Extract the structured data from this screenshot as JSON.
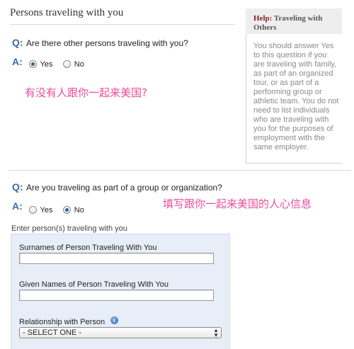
{
  "section_title": "Persons traveling with you",
  "help": {
    "label": "Help:",
    "title_line1": "Traveling with",
    "title_line2": "Others",
    "body": "You should answer Yes to this question if you are traveling with family, as part of an organized tour, or as part of a performing group or athletic team. You do not need to list individuals who are traveling with you for the purposes of employment with the same employer."
  },
  "q1": {
    "q_marker": "Q:",
    "question": "Are there other persons traveling with you?",
    "a_marker": "A:",
    "options": [
      "Yes",
      "No"
    ],
    "selected": "Yes",
    "annotation": "有没有人跟你一起来美国?"
  },
  "q2": {
    "q_marker": "Q:",
    "question": "Are you traveling as part of a group or organization?",
    "a_marker": "A:",
    "options": [
      "Yes",
      "No"
    ],
    "selected": "No",
    "annotation": "填写跟你一起来美国的人心信息"
  },
  "form": {
    "enter_label": "Enter person(s) traveling with you",
    "surnames_label": "Surnames of Person Traveling With You",
    "surnames_value": "",
    "given_label": "Given Names of Person Traveling With You",
    "given_value": "",
    "relationship_label": "Relationship with Person",
    "relationship_selected": "- SELECT ONE -"
  },
  "icons": {
    "info": "info-icon",
    "select_arrow": "up-down-arrows-icon"
  },
  "colors": {
    "accent_blue": "#3a6ea5",
    "annotation_pink": "#ea4d9a",
    "help_label_red": "#8b1a1a",
    "form_panel_bg": "#e8eef7"
  }
}
